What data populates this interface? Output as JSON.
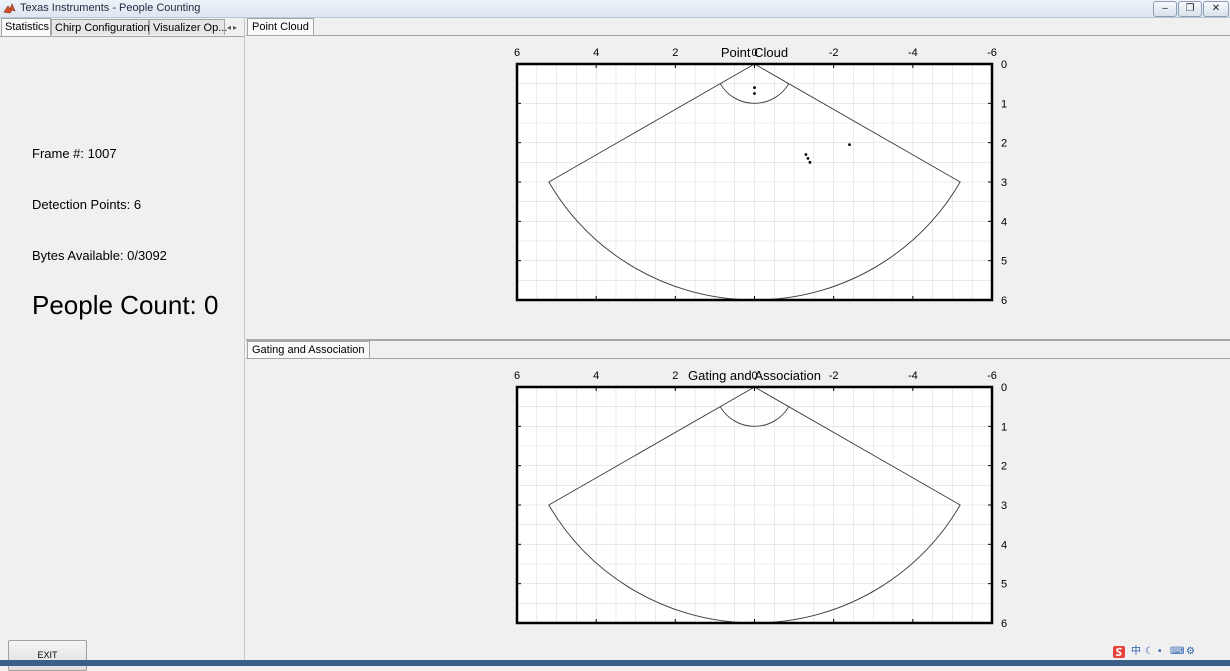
{
  "window": {
    "title": "Texas Instruments - People Counting",
    "controls": {
      "minimize": "–",
      "restore": "❐",
      "close": "✕"
    }
  },
  "left_tabs": [
    {
      "label": "Statistics",
      "active": true
    },
    {
      "label": "Chirp Configuration",
      "active": false
    },
    {
      "label": "Visualizer Op...",
      "active": false
    }
  ],
  "tab_scroll_glyph": "◂▸",
  "stats": {
    "frame": "Frame #: 1007",
    "detection_points": "Detection Points: 6",
    "bytes_available": "Bytes Available: 0/3092",
    "people_count": "People Count: 0"
  },
  "exit_label": "EXIT",
  "panels": {
    "point_cloud_tab": "Point Cloud",
    "gating_tab": "Gating and Association"
  },
  "colors": {
    "plot_frame": "#000000",
    "grid": "#dcdcdc",
    "fov_line": "#3a3a3a",
    "points": "#000000",
    "ime_logo": "#e8433a"
  },
  "ime_icons": [
    "中",
    "☾",
    "•",
    "⌨",
    "⚙"
  ],
  "chart_data": [
    {
      "type": "scatter",
      "title": "Point Cloud",
      "xlabel": "",
      "ylabel": "",
      "xlim": [
        6,
        -6
      ],
      "ylim": [
        0,
        6
      ],
      "x_ticks": [
        "6",
        "4",
        "2",
        "0",
        "-2",
        "-4",
        "-6"
      ],
      "y_ticks": [
        "0",
        "1",
        "2",
        "3",
        "4",
        "5",
        "6"
      ],
      "grid": true,
      "x_axis_location": "top",
      "y_axis_location": "right",
      "y_direction": "down",
      "fov": {
        "half_angle_deg": 60,
        "max_range": 6,
        "min_range": 1
      },
      "points": [
        {
          "x": 0.0,
          "y": 0.6
        },
        {
          "x": 0.0,
          "y": 0.75
        },
        {
          "x": -1.3,
          "y": 2.3
        },
        {
          "x": -1.35,
          "y": 2.4
        },
        {
          "x": -1.4,
          "y": 2.5
        },
        {
          "x": -2.4,
          "y": 2.05
        }
      ]
    },
    {
      "type": "scatter",
      "title": "Gating and Association",
      "xlabel": "",
      "ylabel": "",
      "xlim": [
        6,
        -6
      ],
      "ylim": [
        0,
        6
      ],
      "x_ticks": [
        "6",
        "4",
        "2",
        "0",
        "-2",
        "-4",
        "-6"
      ],
      "y_ticks": [
        "0",
        "1",
        "2",
        "3",
        "4",
        "5",
        "6"
      ],
      "grid": true,
      "x_axis_location": "top",
      "y_axis_location": "right",
      "y_direction": "down",
      "fov": {
        "half_angle_deg": 60,
        "max_range": 6,
        "min_range": 1
      },
      "points": []
    }
  ]
}
